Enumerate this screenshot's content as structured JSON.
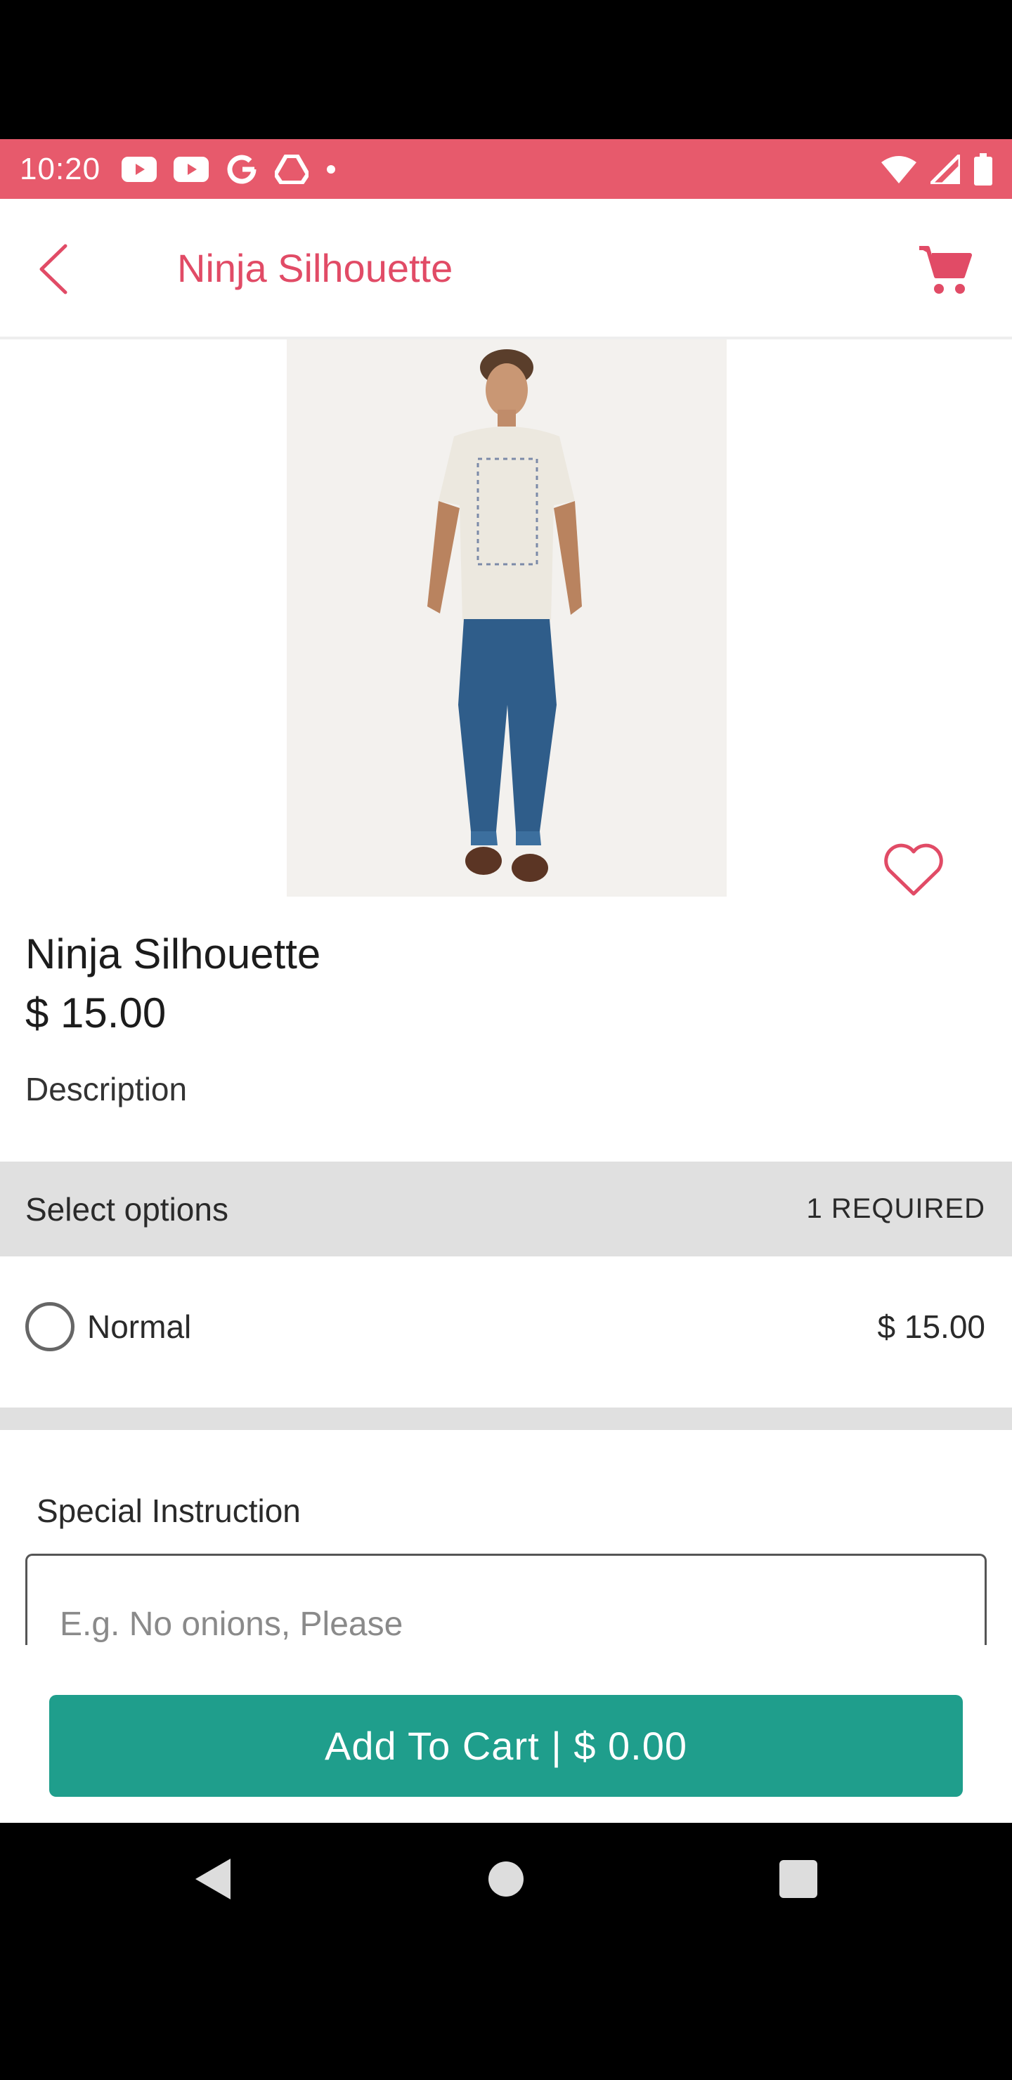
{
  "status_bar": {
    "time": "10:20",
    "left_icons": [
      "youtube-icon",
      "youtube-icon",
      "google-icon",
      "drive-icon",
      "dot-icon"
    ],
    "right_icons": [
      "wifi-icon",
      "signal-icon",
      "battery-icon"
    ]
  },
  "app_bar": {
    "title": "Ninja Silhouette",
    "accent_color": "#e14b66"
  },
  "product": {
    "name": "Ninja Silhouette",
    "price": "$ 15.00",
    "description_label": "Description"
  },
  "options": {
    "title": "Select options",
    "required": "1 REQUIRED",
    "items": [
      {
        "label": "Normal",
        "price": "$ 15.00"
      }
    ]
  },
  "special": {
    "label": "Special Instruction",
    "placeholder": "E.g. No onions, Please"
  },
  "cart": {
    "button_label": "Add To Cart | $ 0.00",
    "button_color": "#1f9e8c"
  }
}
